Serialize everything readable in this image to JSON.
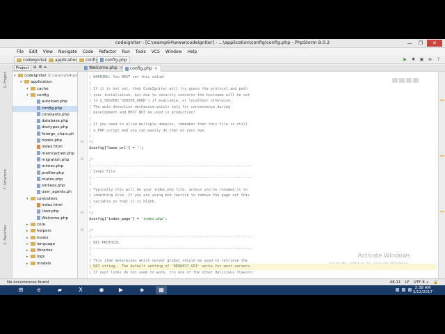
{
  "window": {
    "title": "codeigniter - [C:\\wamp64\\www\\codeigniter] - ...\\application\\config\\config.php - PhpStorm 8.0.2",
    "min_label": "—",
    "max_label": "❐",
    "close_label": "✕"
  },
  "menu": [
    "File",
    "Edit",
    "View",
    "Navigate",
    "Code",
    "Refactor",
    "Run",
    "Tools",
    "VCS",
    "Window",
    "Help"
  ],
  "breadcrumb": [
    "codeigniter",
    "application",
    "config",
    "config.php"
  ],
  "project_panel": {
    "label": "Project",
    "side_labels": [
      "1: Project",
      "7: Structure",
      "2: Favorites"
    ]
  },
  "tabs": [
    {
      "label": "Welcome.php",
      "close": "×"
    },
    {
      "label": "config.php",
      "close": "×"
    }
  ],
  "tree": [
    {
      "level": 0,
      "kind": "folder",
      "label": "codeigniter",
      "note": "(C:\\wamp64\\ww"
    },
    {
      "level": 1,
      "kind": "folder",
      "label": "application"
    },
    {
      "level": 2,
      "kind": "folder",
      "label": "cache"
    },
    {
      "level": 2,
      "kind": "folder",
      "label": "config"
    },
    {
      "level": 3,
      "kind": "file",
      "label": "autoload.php"
    },
    {
      "level": 3,
      "kind": "file",
      "label": "config.php",
      "selected": true
    },
    {
      "level": 3,
      "kind": "file",
      "label": "constants.php"
    },
    {
      "level": 3,
      "kind": "file",
      "label": "database.php"
    },
    {
      "level": 3,
      "kind": "file",
      "label": "doctypes.php"
    },
    {
      "level": 3,
      "kind": "file",
      "label": "foreign_chars.ph"
    },
    {
      "level": 3,
      "kind": "file",
      "label": "hooks.php"
    },
    {
      "level": 3,
      "kind": "html",
      "label": "index.html"
    },
    {
      "level": 3,
      "kind": "file",
      "label": "memcached.php"
    },
    {
      "level": 3,
      "kind": "file",
      "label": "migration.php"
    },
    {
      "level": 3,
      "kind": "file",
      "label": "mimes.php"
    },
    {
      "level": 3,
      "kind": "file",
      "label": "profiler.php"
    },
    {
      "level": 3,
      "kind": "file",
      "label": "routes.php"
    },
    {
      "level": 3,
      "kind": "file",
      "label": "smileys.php"
    },
    {
      "level": 3,
      "kind": "file",
      "label": "user_agents.ph"
    },
    {
      "level": 2,
      "kind": "folder",
      "label": "controllers"
    },
    {
      "level": 3,
      "kind": "html",
      "label": "index.html"
    },
    {
      "level": 3,
      "kind": "file",
      "label": "User.php"
    },
    {
      "level": 3,
      "kind": "file",
      "label": "Welcome.php"
    },
    {
      "level": 2,
      "kind": "folder",
      "label": "core"
    },
    {
      "level": 2,
      "kind": "folder",
      "label": "helpers"
    },
    {
      "level": 2,
      "kind": "folder",
      "label": "hooks"
    },
    {
      "level": 2,
      "kind": "folder",
      "label": "language"
    },
    {
      "level": 2,
      "kind": "folder",
      "label": "libraries"
    },
    {
      "level": 2,
      "kind": "folder",
      "label": "logs"
    },
    {
      "level": 2,
      "kind": "folder",
      "label": "models"
    }
  ],
  "code": [
    {
      "t": "c",
      "text": "| WARNING: You MUST set this value!"
    },
    {
      "t": "c",
      "text": "|"
    },
    {
      "t": "c",
      "text": "| If it is not set, then CodeIgniter will try guess the protocol and path"
    },
    {
      "t": "c",
      "text": "| your installation, but due to security concerns the hostname will be set"
    },
    {
      "t": "c",
      "text": "| to $_SERVER['SERVER_ADDR'] if available, or localhost otherwise."
    },
    {
      "t": "c",
      "text": "| The auto-detection mechanism exists only for convenience during"
    },
    {
      "t": "c",
      "text": "| development and MUST NOT be used in production!"
    },
    {
      "t": "c",
      "text": "|"
    },
    {
      "t": "c",
      "text": "| If you need to allow multiple domains, remember that this file is still"
    },
    {
      "t": "c",
      "text": "| a PHP script and you can easily do that on your own."
    },
    {
      "t": "c",
      "text": "|"
    },
    {
      "t": "c",
      "text": "*/"
    },
    {
      "t": "p",
      "pre": "$config['base_url'] = ",
      "s": "''",
      "post": ";"
    },
    {
      "t": "c",
      "text": ""
    },
    {
      "t": "c",
      "text": "/*"
    },
    {
      "t": "c",
      "text": "|--------------------------------------------------------------------------"
    },
    {
      "t": "c",
      "text": "| Index File"
    },
    {
      "t": "c",
      "text": "|--------------------------------------------------------------------------"
    },
    {
      "t": "c",
      "text": "|"
    },
    {
      "t": "c",
      "text": "| Typically this will be your index.php file, unless you've renamed it to"
    },
    {
      "t": "c",
      "text": "| something else. If you are using mod_rewrite to remove the page set this"
    },
    {
      "t": "c",
      "text": "| variable so that it is blank."
    },
    {
      "t": "c",
      "text": "|"
    },
    {
      "t": "c",
      "text": "*/"
    },
    {
      "t": "p",
      "pre": "$config['index_page'] = ",
      "s": "'index.php'",
      "post": ";"
    },
    {
      "t": "c",
      "text": ""
    },
    {
      "t": "c",
      "text": "/*"
    },
    {
      "t": "c",
      "text": "|--------------------------------------------------------------------------"
    },
    {
      "t": "c",
      "text": "| URI PROTOCOL"
    },
    {
      "t": "c",
      "text": "|--------------------------------------------------------------------------"
    },
    {
      "t": "c",
      "text": "|"
    },
    {
      "t": "c",
      "text": "| This item determines which server global should be used to retrieve the"
    },
    {
      "t": "c",
      "text": "| URI string.  The default setting of 'REQUEST_URI' works for most servers.",
      "hl": true
    },
    {
      "t": "c",
      "text": "| If your links do not seem to work, try one of the other delicious flavors:"
    }
  ],
  "watermark": {
    "title": "Activate Windows",
    "subtitle": "Go to PC settings to activate Windows."
  },
  "status": {
    "message": "No occurrences found",
    "position": "48:11",
    "line_sep": "LF",
    "encoding": "UTF-8 ÷"
  },
  "clock": {
    "time": "2:38 AM",
    "date": "3/12/2017"
  }
}
